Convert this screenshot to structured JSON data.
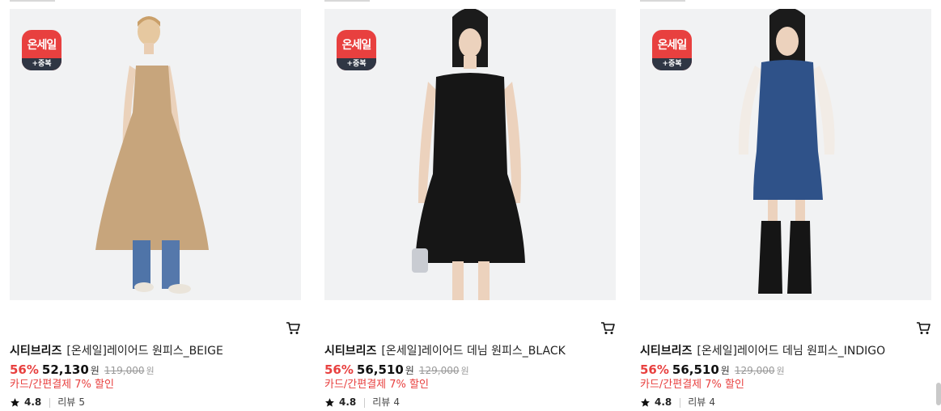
{
  "badge": {
    "main": "온세일",
    "sub": "+중복"
  },
  "review_label": "리뷰",
  "icons": {
    "cart": "cart-icon",
    "star": "star-icon"
  },
  "colors": {
    "accent": "#e8403f",
    "badge_bottom": "#2f3644",
    "image_bg": "#f1f2f3"
  },
  "products": [
    {
      "brand": "시티브리즈",
      "name": "[온세일]레이어드 원피스_BEIGE",
      "discount_rate": "56%",
      "sale_price": "52,130",
      "currency": "원",
      "original_price": "119,000",
      "card_discount": "카드/간편결제 7% 할인",
      "rating": "4.8",
      "review_count": "5"
    },
    {
      "brand": "시티브리즈",
      "name": "[온세일]레이어드 데님 원피스_BLACK",
      "discount_rate": "56%",
      "sale_price": "56,510",
      "currency": "원",
      "original_price": "129,000",
      "card_discount": "카드/간편결제 7% 할인",
      "rating": "4.8",
      "review_count": "4"
    },
    {
      "brand": "시티브리즈",
      "name": "[온세일]레이어드 데님 원피스_INDIGO",
      "discount_rate": "56%",
      "sale_price": "56,510",
      "currency": "원",
      "original_price": "129,000",
      "card_discount": "카드/간편결제 7% 할인",
      "rating": "4.8",
      "review_count": "4"
    }
  ]
}
